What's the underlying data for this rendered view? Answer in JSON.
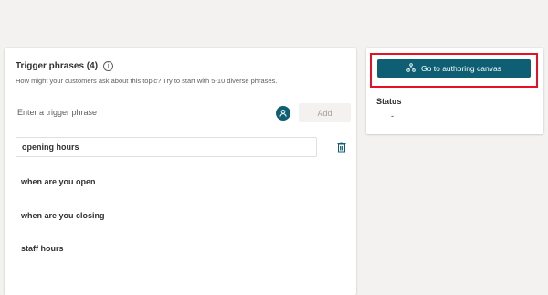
{
  "trigger_section": {
    "title": "Trigger phrases (4)",
    "info_icon": "info-icon",
    "helper_text": "How might your customers ask about this topic? Try to start with 5-10 diverse phrases.",
    "input_placeholder": "Enter a trigger phrase",
    "add_label": "Add",
    "phrases": [
      "opening hours",
      "when are you open",
      "when are you closing",
      "staff hours"
    ]
  },
  "side_panel": {
    "authoring_label": "Go to authoring canvas",
    "authoring_icon": "flow-icon",
    "status_label": "Status",
    "status_value": "-"
  },
  "colors": {
    "accent": "#0f5f74",
    "highlight": "#e81123",
    "trash": "#0f5f74"
  }
}
